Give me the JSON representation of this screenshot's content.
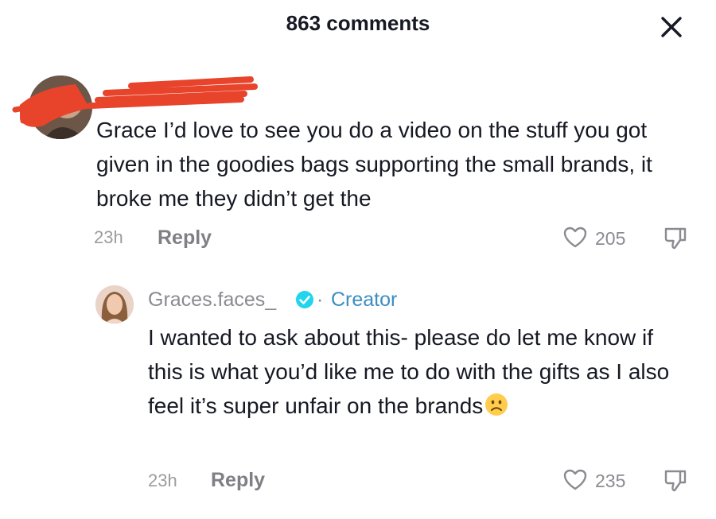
{
  "header": {
    "title": "863 comments",
    "close_icon": "close-icon"
  },
  "comments": [
    {
      "text": "Grace I’d love to see you do a video on the stuff you got given in the goodies bags supporting the small brands, it broke me they didn’t get the",
      "time": "23h",
      "reply_label": "Reply",
      "likes": "205"
    }
  ],
  "reply": {
    "username": "Graces.faces_",
    "separator": "·",
    "badge": "Creator",
    "text": "I wanted to ask about this- please do let me know if this is what you’d like me to do with the gifts as I also feel it’s super unfair on the brands",
    "time": "23h",
    "reply_label": "Reply",
    "likes": "235"
  },
  "colors": {
    "text": "#161823",
    "muted": "#8a8b91",
    "creator": "#3b8ec2",
    "redaction": "#e8432b"
  }
}
